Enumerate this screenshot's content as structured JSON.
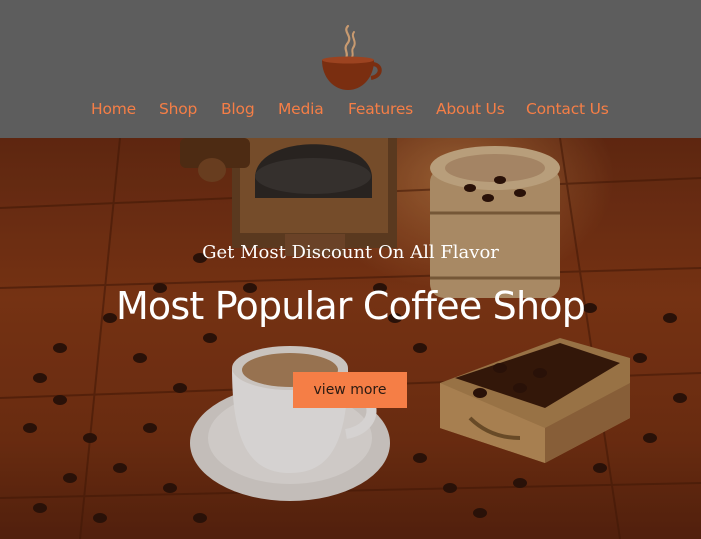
{
  "brand": {
    "logo_icon": "coffee-cup-icon",
    "accent": "#f57e46",
    "header_bg": "#5d5d5d"
  },
  "nav": {
    "items": [
      {
        "label": "Home"
      },
      {
        "label": "Shop"
      },
      {
        "label": "Blog"
      },
      {
        "label": "Media"
      },
      {
        "label": "Features"
      },
      {
        "label": "About Us"
      },
      {
        "label": "Contact Us"
      }
    ]
  },
  "hero": {
    "subtitle": "Get Most Discount On All Flavor",
    "title": "Most Popular Coffee Shop",
    "cta_label": "view more"
  }
}
